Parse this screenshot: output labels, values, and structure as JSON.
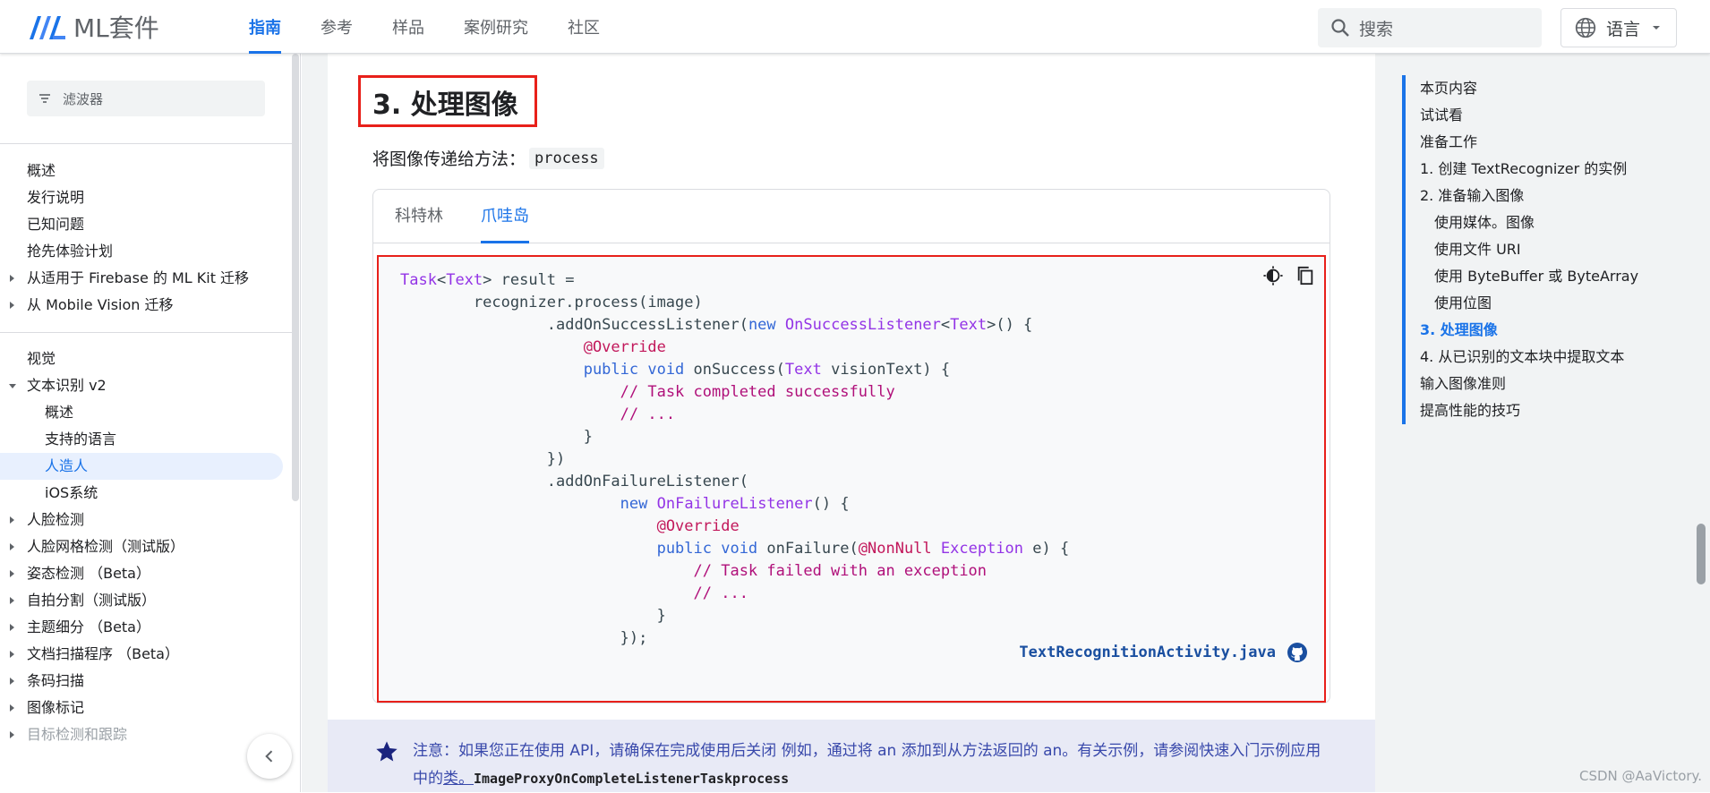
{
  "header": {
    "logo_text": "ML套件",
    "tabs": [
      {
        "label": "指南",
        "active": true
      },
      {
        "label": "参考",
        "active": false
      },
      {
        "label": "样品",
        "active": false
      },
      {
        "label": "案例研究",
        "active": false
      },
      {
        "label": "社区",
        "active": false
      }
    ],
    "search_placeholder": "搜索",
    "language_label": "语言"
  },
  "sidebar": {
    "filter_placeholder": "滤波器",
    "group1": [
      "概述",
      "发行说明",
      "已知问题",
      "抢先体验计划",
      "从适用于 Firebase 的 ML Kit 迁移",
      "从 Mobile Vision 迁移"
    ],
    "group2_heading": "视觉",
    "text_recognition": "文本识别 v2",
    "text_recognition_children": [
      "概述",
      "支持的语言",
      "人造人",
      "iOS系统"
    ],
    "group2_rest": [
      "人脸检测",
      "人脸网格检测（测试版）",
      "姿态检测 （Beta）",
      "自拍分割（测试版）",
      "主题细分 （Beta）",
      "文档扫描程序 （Beta）",
      "条码扫描",
      "图像标记",
      "目标检测和跟踪"
    ]
  },
  "main": {
    "heading": "3. 处理图像",
    "lead_text": "将图像传递给方法：",
    "lead_code": "process",
    "code_tabs": [
      {
        "label": "科特林",
        "active": false
      },
      {
        "label": "爪哇岛",
        "active": true
      }
    ],
    "source_file": "TextRecognitionActivity.java",
    "note_label": "注意：",
    "note_text": "如果您正在使用 API，请确保在完成使用后关闭 例如，通过将 an 添加到从方法返回的 an。有关示例，请参阅快速入门示例应用中的",
    "note_link": "类。",
    "note_code": "ImageProxyOnCompleteListenerTaskprocess"
  },
  "toc": {
    "items": [
      {
        "label": "本页内容",
        "level": 0,
        "active": false
      },
      {
        "label": "试试看",
        "level": 0,
        "active": false
      },
      {
        "label": "准备工作",
        "level": 0,
        "active": false
      },
      {
        "label": "1. 创建 TextRecognizer 的实例",
        "level": 0,
        "active": false
      },
      {
        "label": "2. 准备输入图像",
        "level": 0,
        "active": false
      },
      {
        "label": "使用媒体。图像",
        "level": 1,
        "active": false
      },
      {
        "label": "使用文件 URI",
        "level": 1,
        "active": false
      },
      {
        "label": "使用 ByteBuffer 或 ByteArray",
        "level": 1,
        "active": false
      },
      {
        "label": "使用位图",
        "level": 1,
        "active": false
      },
      {
        "label": "3. 处理图像",
        "level": 0,
        "active": true
      },
      {
        "label": "4. 从已识别的文本块中提取文本",
        "level": 0,
        "active": false
      },
      {
        "label": "输入图像准则",
        "level": 0,
        "active": false
      },
      {
        "label": "提高性能的技巧",
        "level": 0,
        "active": false
      }
    ]
  },
  "watermark": "CSDN @AaVictory.",
  "colors": {
    "accent": "#1a73e8",
    "highlight_box": "#e8201a",
    "note_bg": "#e8eaf6"
  },
  "icons": [
    "ml-kit-logo-icon",
    "search-icon",
    "globe-icon",
    "dropdown-arrow-icon",
    "filter-icon",
    "collapse-chevron-icon",
    "theme-toggle-icon",
    "copy-icon",
    "github-icon",
    "star-icon"
  ]
}
